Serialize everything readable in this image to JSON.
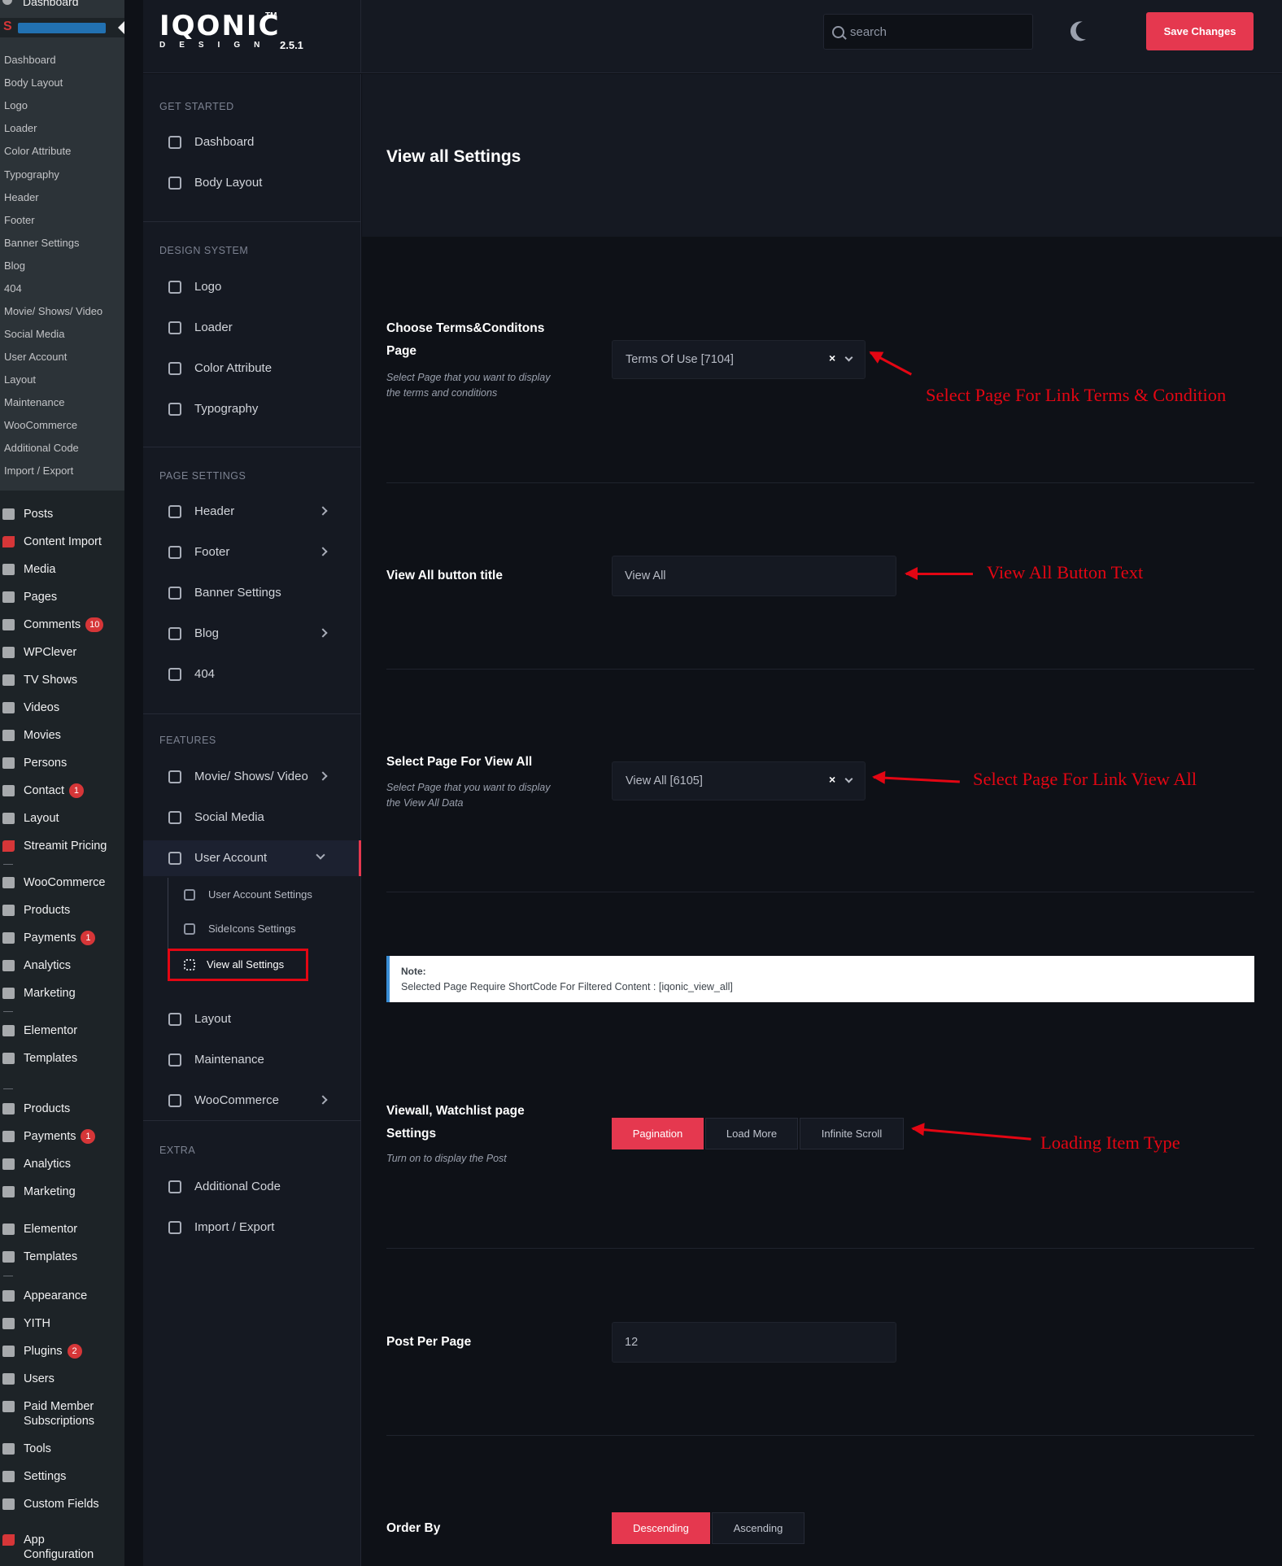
{
  "wp_admin": {
    "dashboard_label": "Dashboard",
    "submenu": [
      "Dashboard",
      "Body Layout",
      "Logo",
      "Loader",
      "Color Attribute",
      "Typography",
      "Header",
      "Footer",
      "Banner Settings",
      "Blog",
      "404",
      "Movie/ Shows/ Video",
      "Social Media",
      "User Account",
      "Layout",
      "Maintenance",
      "WooCommerce",
      "Additional Code",
      "Import / Export"
    ],
    "menu": [
      {
        "label": "Posts",
        "icon": "pin-icon"
      },
      {
        "label": "Content Import",
        "icon": "streamit-icon"
      },
      {
        "label": "Media",
        "icon": "media-icon"
      },
      {
        "label": "Pages",
        "icon": "pages-icon"
      },
      {
        "label": "Comments",
        "icon": "comment-icon",
        "badge": "10"
      },
      {
        "label": "WPClever",
        "icon": "bulb-icon"
      },
      {
        "label": "TV Shows",
        "icon": "tv-icon"
      },
      {
        "label": "Videos",
        "icon": "video-icon"
      },
      {
        "label": "Movies",
        "icon": "film-icon"
      },
      {
        "label": "Persons",
        "icon": "person-icon"
      },
      {
        "label": "Contact",
        "icon": "mail-icon",
        "badge": "1"
      },
      {
        "label": "Layout",
        "icon": "layout-icon"
      },
      {
        "label": "Streamit Pricing",
        "icon": "streamit-icon"
      },
      {
        "label": "WooCommerce",
        "icon": "woo-icon"
      },
      {
        "label": "Products",
        "icon": "products-icon"
      },
      {
        "label": "Payments",
        "icon": "payments-icon",
        "badge": "1"
      },
      {
        "label": "Analytics",
        "icon": "analytics-icon"
      },
      {
        "label": "Marketing",
        "icon": "megaphone-icon"
      },
      {
        "label": "Elementor",
        "icon": "elementor-icon"
      },
      {
        "label": "Templates",
        "icon": "folder-icon"
      },
      {
        "label": "Products",
        "icon": "products-icon"
      },
      {
        "label": "Payments",
        "icon": "payments-icon",
        "badge": "1"
      },
      {
        "label": "Analytics",
        "icon": "analytics-icon"
      },
      {
        "label": "Marketing",
        "icon": "megaphone-icon"
      },
      {
        "label": "Elementor",
        "icon": "elementor-icon"
      },
      {
        "label": "Templates",
        "icon": "folder-icon"
      },
      {
        "label": "Appearance",
        "icon": "brush-icon"
      },
      {
        "label": "YITH",
        "icon": "yith-icon"
      },
      {
        "label": "Plugins",
        "icon": "plug-icon",
        "badge": "2"
      },
      {
        "label": "Users",
        "icon": "users-icon"
      },
      {
        "label": "Paid Member",
        "label2": "Subscriptions",
        "icon": "member-icon"
      },
      {
        "label": "Tools",
        "icon": "wrench-icon"
      },
      {
        "label": "Settings",
        "icon": "settings-icon"
      },
      {
        "label": "Custom Fields",
        "icon": "fields-icon"
      },
      {
        "label": "App",
        "label2": "Configuration",
        "icon": "streamit-icon"
      }
    ]
  },
  "header": {
    "logo_word": "IQONIC",
    "logo_tm": "TM",
    "logo_sub": "DESIGN",
    "version": "2.5.1",
    "search_placeholder": "search",
    "save_label": "Save Changes"
  },
  "nav": {
    "sections": [
      {
        "title": "GET STARTED",
        "items": [
          {
            "label": "Dashboard",
            "icon": "grid-icon"
          },
          {
            "label": "Body Layout",
            "icon": "gauge-icon"
          }
        ]
      },
      {
        "title": "DESIGN SYSTEM",
        "items": [
          {
            "label": "Logo",
            "icon": "flag-icon"
          },
          {
            "label": "Loader",
            "icon": "spinner-icon"
          },
          {
            "label": "Color Attribute",
            "icon": "contrast-icon"
          },
          {
            "label": "Typography",
            "icon": "font-icon"
          }
        ]
      },
      {
        "title": "PAGE SETTINGS",
        "items": [
          {
            "label": "Header",
            "icon": "window-icon",
            "chevron": true
          },
          {
            "label": "Footer",
            "icon": "laptop-icon",
            "chevron": true
          },
          {
            "label": "Banner Settings",
            "icon": "code-icon"
          },
          {
            "label": "Blog",
            "icon": "quote-icon",
            "chevron": true
          },
          {
            "label": "404",
            "icon": "minus-circle-icon"
          }
        ]
      },
      {
        "title": "FEATURES",
        "items": [
          {
            "label": "Movie/ Shows/ Video",
            "icon": "window-icon",
            "chevron": true
          },
          {
            "label": "Social Media",
            "icon": "share-icon"
          },
          {
            "label": "User Account",
            "icon": "user-circle-icon",
            "chevron": true,
            "active": true
          }
        ]
      },
      {
        "title": "EXTRA",
        "items": [
          {
            "label": "Additional Code",
            "icon": "code-box-icon"
          },
          {
            "label": "Import / Export",
            "icon": "cloud-icon"
          }
        ]
      }
    ],
    "user_account_sub": [
      {
        "label": "User Account Settings",
        "icon": "user-gear-icon"
      },
      {
        "label": "SideIcons Settings",
        "icon": "sideicons-icon"
      },
      {
        "label": "View all Settings",
        "icon": "frame-icon",
        "current": true
      }
    ],
    "after_sub": [
      {
        "label": "Layout",
        "icon": "list-icon"
      },
      {
        "label": "Maintenance",
        "icon": "maintenance-icon"
      },
      {
        "label": "WooCommerce",
        "icon": "store-icon",
        "chevron": true
      }
    ]
  },
  "content": {
    "page_title": "View all Settings",
    "terms": {
      "label_line1": "Choose Terms&Conditons",
      "label_line2": "Page",
      "help_line1": "Select Page that you want to display",
      "help_line2": "the terms and conditions",
      "value": "Terms Of Use [7104]"
    },
    "view_all_title": {
      "label": "View All button title",
      "value": "View All"
    },
    "view_all_page": {
      "label": "Select Page For View All",
      "help_line1": "Select Page that you want to display",
      "help_line2": "the View All Data",
      "value": "View All [6105]"
    },
    "note": {
      "title": "Note:",
      "text": "Selected Page Require ShortCode For Filtered Content : [iqonic_view_all]"
    },
    "watchlist": {
      "label_line1": "Viewall, Watchlist page",
      "label_line2": "Settings",
      "help": "Turn on to display the Post",
      "options": [
        "Pagination",
        "Load More",
        "Infinite Scroll"
      ],
      "selected": "Pagination"
    },
    "post_per_page": {
      "label": "Post Per Page",
      "value": "12"
    },
    "order_by": {
      "label": "Order By",
      "options": [
        "Descending",
        "Ascending"
      ],
      "selected": "Descending"
    },
    "clear_symbol": "×"
  },
  "annotations": {
    "terms": "Select Page For Link Terms & Condition",
    "button_text": "View All Button Text",
    "view_all": "Select Page For Link View All",
    "loading": "Loading Item Type"
  },
  "colors": {
    "accent": "#e5384f",
    "annotation": "#e30613",
    "bg": "#0e1117",
    "panel": "#151922"
  }
}
